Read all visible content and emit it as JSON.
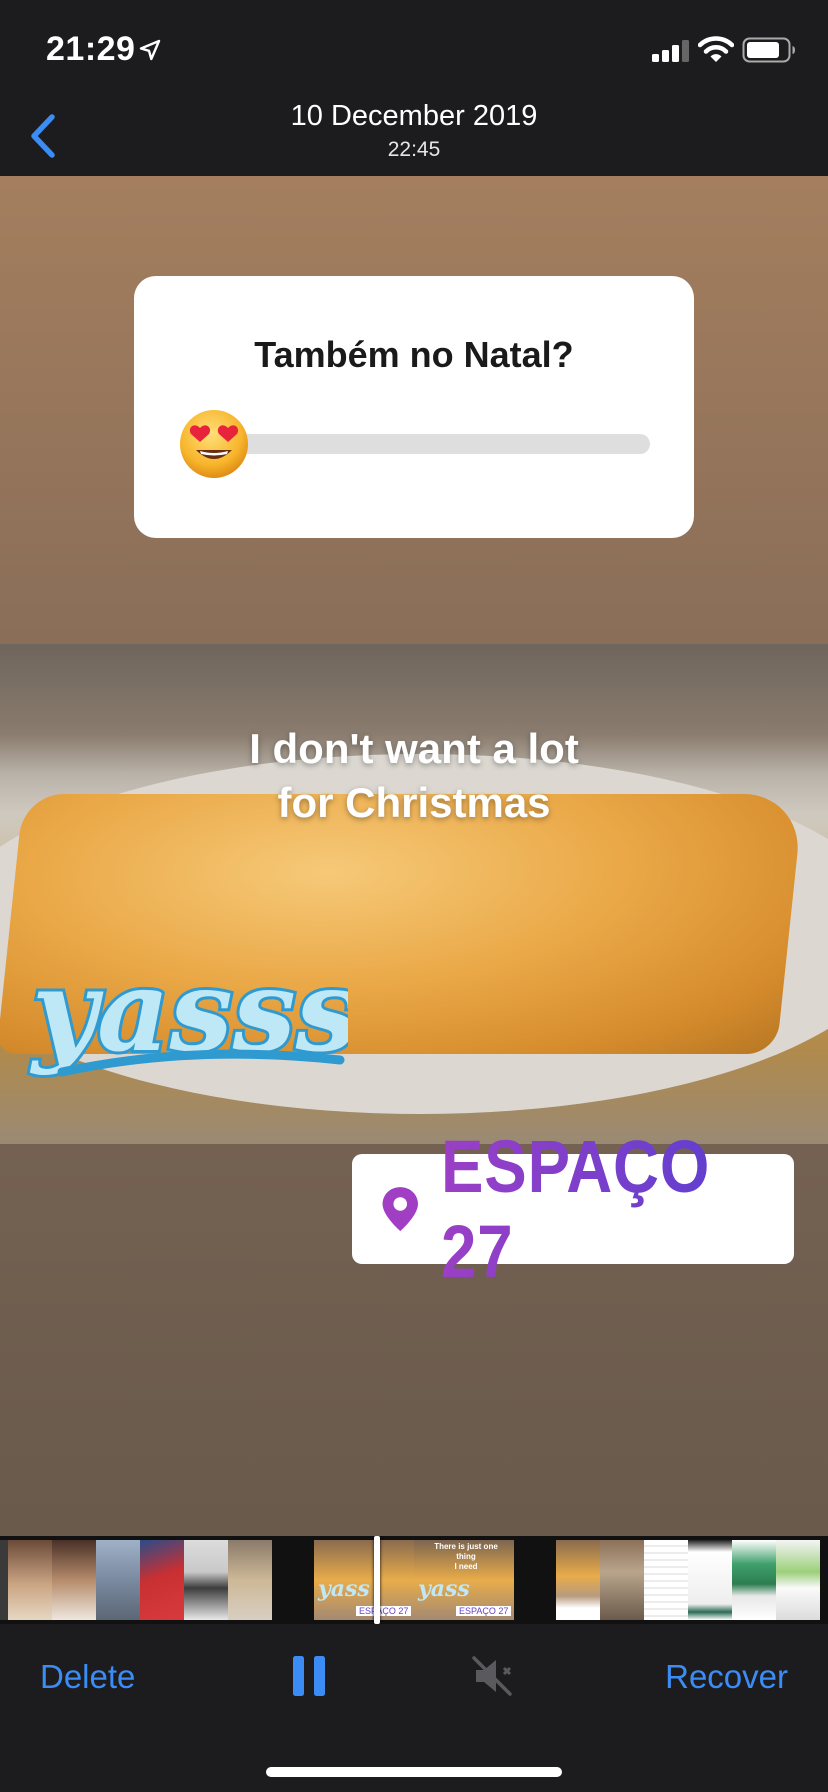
{
  "status_bar": {
    "time": "21:29",
    "icons": [
      "location-arrow-icon",
      "signal-icon",
      "wifi-icon",
      "battery-icon"
    ]
  },
  "nav": {
    "title": "10 December 2019",
    "subtitle": "22:45",
    "back_icon": "chevron-left-icon"
  },
  "story": {
    "poll": {
      "question": "Também no Natal?",
      "emoji": "heart-eyes-emoji",
      "slider_value": 0.0
    },
    "photo": {
      "caption_line1": "I don't want a lot",
      "caption_line2": "for Christmas",
      "sticker_text": "yasss"
    },
    "location": {
      "icon": "map-pin-icon",
      "label": "ESPAÇO 27"
    }
  },
  "filmstrip": {
    "group2_captions": [
      "There is just one thing",
      "I need"
    ],
    "location_tag": "ESPAÇO 27"
  },
  "toolbar": {
    "delete_label": "Delete",
    "recover_label": "Recover",
    "pause_icon": "pause-icon",
    "mute_icon": "speaker-muted-icon"
  },
  "colors": {
    "accent": "#3b8cf5",
    "background": "#1c1c1e"
  }
}
